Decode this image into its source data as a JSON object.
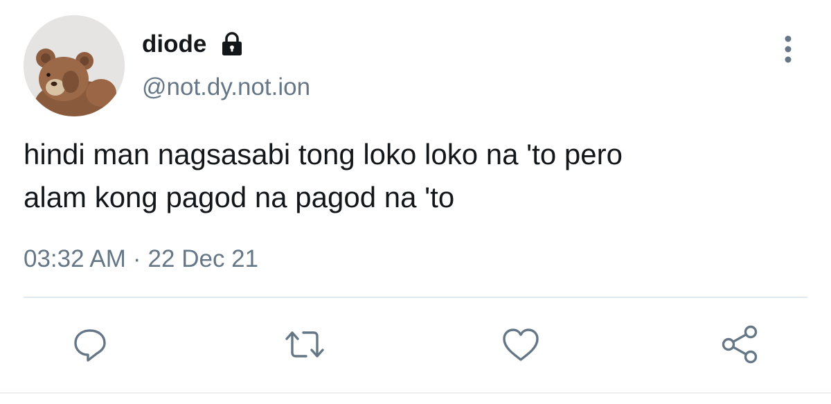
{
  "author": {
    "display_name": "diode",
    "handle": "@not.dy.not.ion",
    "protected_icon": "lock-icon",
    "avatar": "teddy-bear-avatar"
  },
  "tweet": {
    "text": "hindi man nagsasabi tong loko loko na 'to pero\nalam kong pagod na pagod na 'to",
    "time": "03:32 AM",
    "separator": "·",
    "date": "22 Dec 21"
  },
  "actions": {
    "reply_icon": "reply-icon",
    "retweet_icon": "retweet-icon",
    "like_icon": "heart-icon",
    "share_icon": "share-icon",
    "more_icon": "more-vertical-icon"
  },
  "colors": {
    "text": "#14171a",
    "secondary": "#657786",
    "divider": "#e1e8ed"
  }
}
